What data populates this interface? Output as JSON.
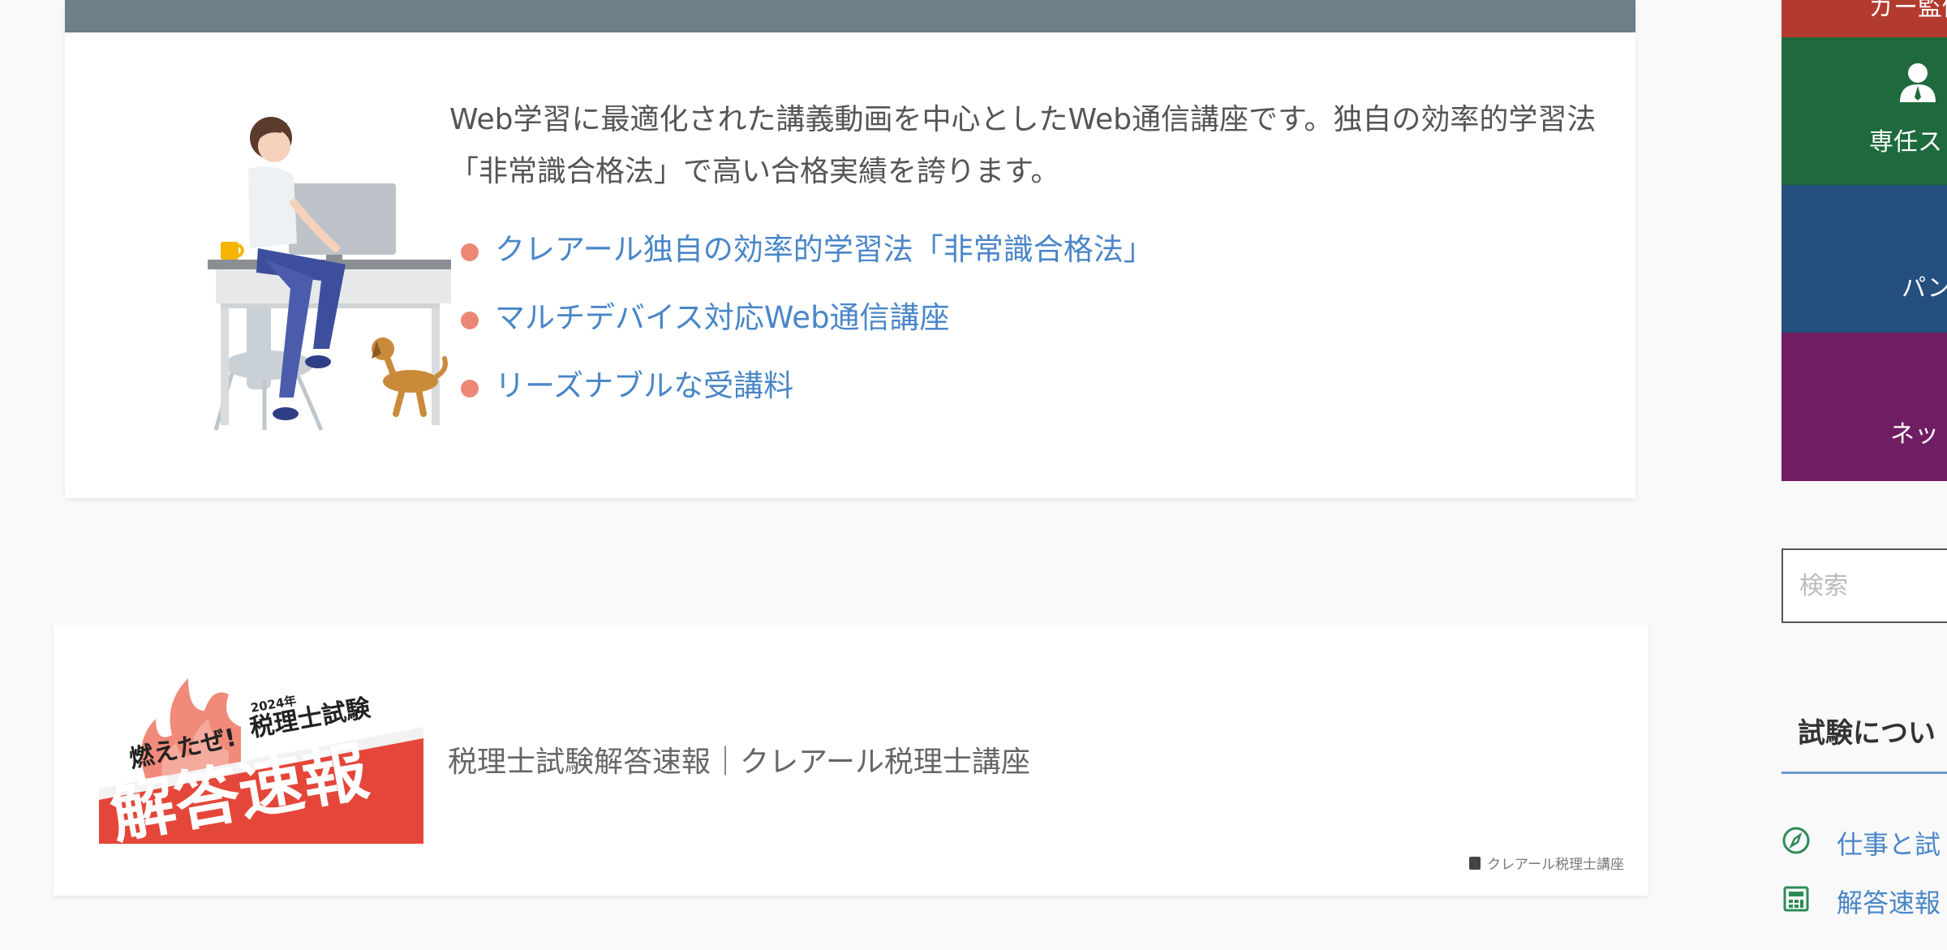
{
  "main": {
    "intro_text": "Web学習に最適化された講義動画を中心としたWeb通信講座です。独自の効率的学習法「非常識合格法」で高い合格実績を誇ります。",
    "features": [
      {
        "label": "クレアール独自の効率的学習法「非常識合格法」"
      },
      {
        "label": "マルチデバイス対応Web通信講座"
      },
      {
        "label": "リーズナブルな受講料"
      }
    ],
    "link_card": {
      "banner_top": "2024年",
      "banner_exam": "税理士試験",
      "banner_tagline": "燃えたぜ!",
      "banner_main": "解答速報",
      "title": "税理士試験解答速報｜クレアール税理士講座",
      "site_name": "クレアール税理士講座"
    }
  },
  "sidebar": {
    "tiles": [
      {
        "label": "ガー監修"
      },
      {
        "label": "専任ス"
      },
      {
        "label": "パン"
      },
      {
        "label": "ネッ"
      }
    ],
    "search": {
      "placeholder": "検索"
    },
    "heading": "試験につい",
    "links": [
      {
        "label": "仕事と試",
        "icon": "compass-icon"
      },
      {
        "label": "解答速報",
        "icon": "calculator-icon"
      }
    ]
  },
  "colors": {
    "card_header": "#6d7f88",
    "link": "#4a86c8",
    "bullet": "#ec8776",
    "tile_red": "#b23a2e",
    "tile_green": "#1f6a3c",
    "tile_blue": "#244f7e",
    "tile_purple": "#701e64",
    "banner_red": "#e4473a"
  }
}
